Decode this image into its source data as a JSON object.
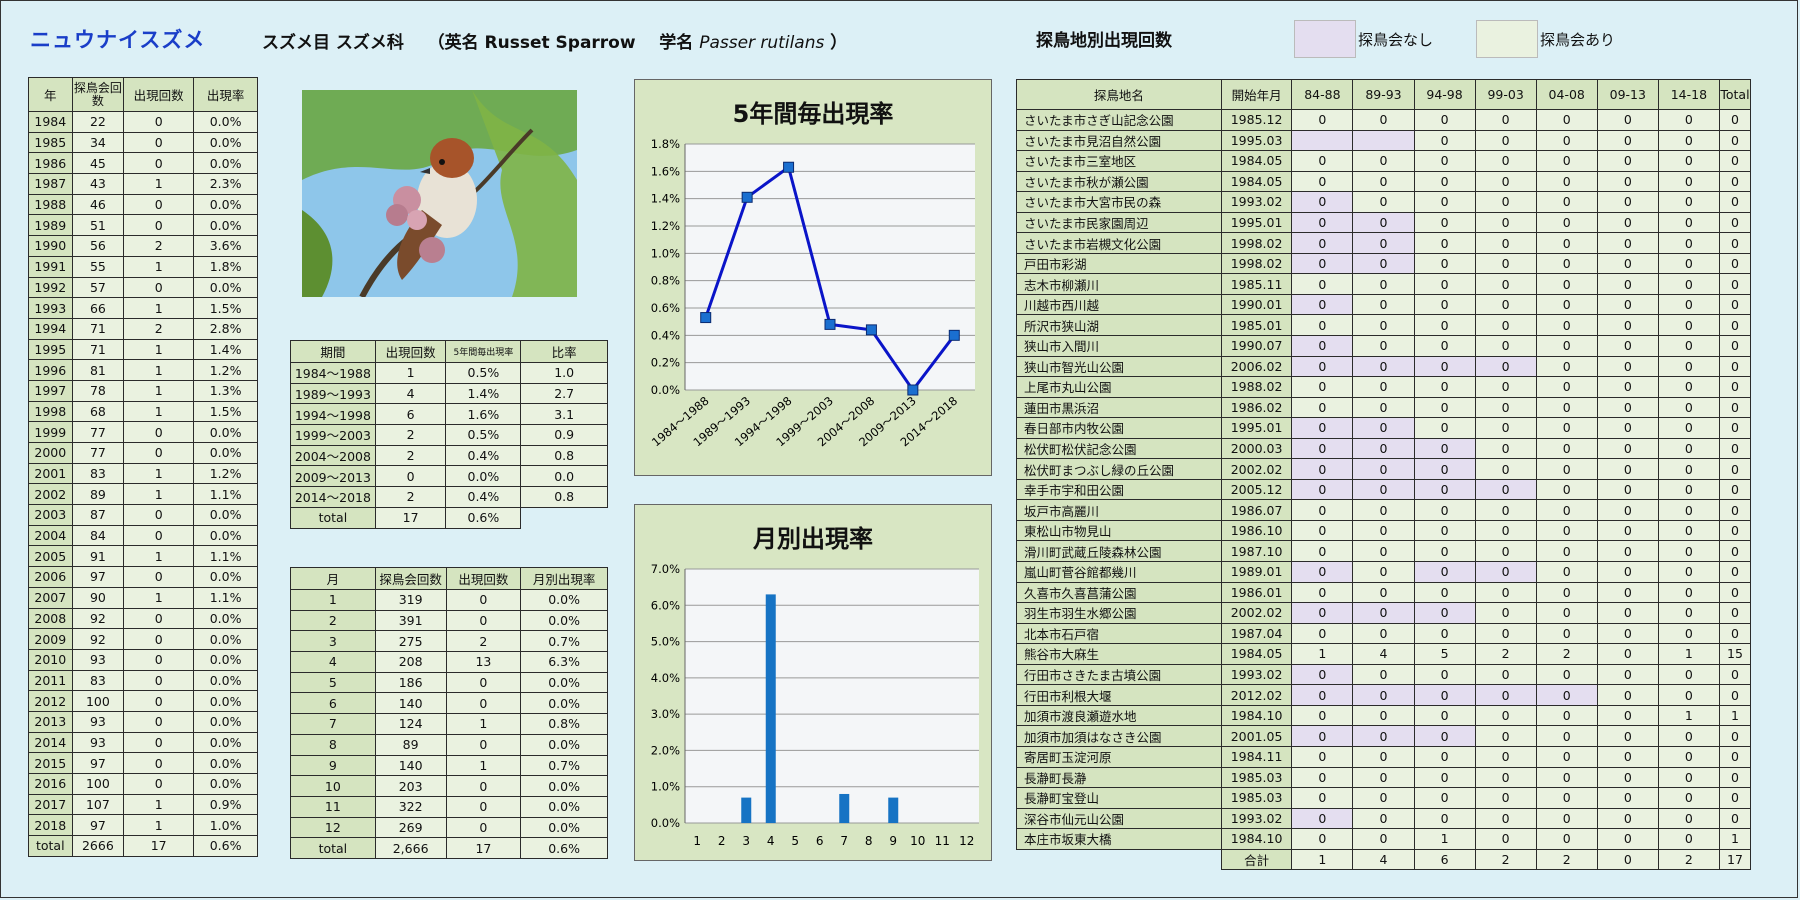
{
  "header": {
    "title": "ニュウナイスズメ",
    "order_family": "スズメ目 スズメ科",
    "english_prefix": "（英名 Russet Sparrow",
    "sci_prefix": "学名",
    "sci_name": "Passer rutilans",
    "close_paren": "）",
    "site_table_title": "探鳥地別出現回数",
    "legend_none": "探鳥会なし",
    "legend_exists": "探鳥会あり"
  },
  "colors": {
    "lavender": "#e4def0",
    "green_light": "#eaf2e0",
    "green_header": "#d5e4c0",
    "line": "#0a14c8",
    "bar": "#1673c4",
    "title": "#1a3ec8"
  },
  "year_table": {
    "headers": [
      "年",
      "探鳥会回数",
      "出現回数",
      "出現率"
    ],
    "rows": [
      [
        "1984",
        "22",
        "0",
        "0.0%"
      ],
      [
        "1985",
        "34",
        "0",
        "0.0%"
      ],
      [
        "1986",
        "45",
        "0",
        "0.0%"
      ],
      [
        "1987",
        "43",
        "1",
        "2.3%"
      ],
      [
        "1988",
        "46",
        "0",
        "0.0%"
      ],
      [
        "1989",
        "51",
        "0",
        "0.0%"
      ],
      [
        "1990",
        "56",
        "2",
        "3.6%"
      ],
      [
        "1991",
        "55",
        "1",
        "1.8%"
      ],
      [
        "1992",
        "57",
        "0",
        "0.0%"
      ],
      [
        "1993",
        "66",
        "1",
        "1.5%"
      ],
      [
        "1994",
        "71",
        "2",
        "2.8%"
      ],
      [
        "1995",
        "71",
        "1",
        "1.4%"
      ],
      [
        "1996",
        "81",
        "1",
        "1.2%"
      ],
      [
        "1997",
        "78",
        "1",
        "1.3%"
      ],
      [
        "1998",
        "68",
        "1",
        "1.5%"
      ],
      [
        "1999",
        "77",
        "0",
        "0.0%"
      ],
      [
        "2000",
        "77",
        "0",
        "0.0%"
      ],
      [
        "2001",
        "83",
        "1",
        "1.2%"
      ],
      [
        "2002",
        "89",
        "1",
        "1.1%"
      ],
      [
        "2003",
        "87",
        "0",
        "0.0%"
      ],
      [
        "2004",
        "84",
        "0",
        "0.0%"
      ],
      [
        "2005",
        "91",
        "1",
        "1.1%"
      ],
      [
        "2006",
        "97",
        "0",
        "0.0%"
      ],
      [
        "2007",
        "90",
        "1",
        "1.1%"
      ],
      [
        "2008",
        "92",
        "0",
        "0.0%"
      ],
      [
        "2009",
        "92",
        "0",
        "0.0%"
      ],
      [
        "2010",
        "93",
        "0",
        "0.0%"
      ],
      [
        "2011",
        "83",
        "0",
        "0.0%"
      ],
      [
        "2012",
        "100",
        "0",
        "0.0%"
      ],
      [
        "2013",
        "93",
        "0",
        "0.0%"
      ],
      [
        "2014",
        "93",
        "0",
        "0.0%"
      ],
      [
        "2015",
        "97",
        "0",
        "0.0%"
      ],
      [
        "2016",
        "100",
        "0",
        "0.0%"
      ],
      [
        "2017",
        "107",
        "1",
        "0.9%"
      ],
      [
        "2018",
        "97",
        "1",
        "1.0%"
      ]
    ],
    "total": [
      "total",
      "2666",
      "17",
      "0.6%"
    ]
  },
  "period_table": {
    "headers": [
      "期間",
      "出現回数",
      "5年間毎出現率",
      "比率"
    ],
    "rows": [
      [
        "1984～1988",
        "1",
        "0.5%",
        "1.0"
      ],
      [
        "1989～1993",
        "4",
        "1.4%",
        "2.7"
      ],
      [
        "1994～1998",
        "6",
        "1.6%",
        "3.1"
      ],
      [
        "1999～2003",
        "2",
        "0.5%",
        "0.9"
      ],
      [
        "2004～2008",
        "2",
        "0.4%",
        "0.8"
      ],
      [
        "2009～2013",
        "0",
        "0.0%",
        "0.0"
      ],
      [
        "2014～2018",
        "2",
        "0.4%",
        "0.8"
      ]
    ],
    "total": [
      "total",
      "17",
      "0.6%"
    ]
  },
  "month_table": {
    "headers": [
      "月",
      "探鳥会回数",
      "出現回数",
      "月別出現率"
    ],
    "rows": [
      [
        "1",
        "319",
        "0",
        "0.0%"
      ],
      [
        "2",
        "391",
        "0",
        "0.0%"
      ],
      [
        "3",
        "275",
        "2",
        "0.7%"
      ],
      [
        "4",
        "208",
        "13",
        "6.3%"
      ],
      [
        "5",
        "186",
        "0",
        "0.0%"
      ],
      [
        "6",
        "140",
        "0",
        "0.0%"
      ],
      [
        "7",
        "124",
        "1",
        "0.8%"
      ],
      [
        "8",
        "89",
        "0",
        "0.0%"
      ],
      [
        "9",
        "140",
        "1",
        "0.7%"
      ],
      [
        "10",
        "203",
        "0",
        "0.0%"
      ],
      [
        "11",
        "322",
        "0",
        "0.0%"
      ],
      [
        "12",
        "269",
        "0",
        "0.0%"
      ]
    ],
    "total": [
      "total",
      "2,666",
      "17",
      "0.6%"
    ]
  },
  "site_table": {
    "headers": [
      "探鳥地名",
      "開始年月",
      "84-88",
      "89-93",
      "94-98",
      "99-03",
      "04-08",
      "09-13",
      "14-18",
      "Total"
    ],
    "rows": [
      {
        "name": "さいたま市さぎ山記念公園",
        "start": "1985.12",
        "v": [
          "0",
          "0",
          "0",
          "0",
          "0",
          "0",
          "0",
          "0"
        ],
        "lav": []
      },
      {
        "name": "さいたま市見沼自然公園",
        "start": "1995.03",
        "v": [
          "",
          "",
          "0",
          "0",
          "0",
          "0",
          "0",
          "0"
        ],
        "lav": [
          0,
          1
        ]
      },
      {
        "name": "さいたま市三室地区",
        "start": "1984.05",
        "v": [
          "0",
          "0",
          "0",
          "0",
          "0",
          "0",
          "0",
          "0"
        ],
        "lav": []
      },
      {
        "name": "さいたま市秋が瀬公園",
        "start": "1984.05",
        "v": [
          "0",
          "0",
          "0",
          "0",
          "0",
          "0",
          "0",
          "0"
        ],
        "lav": []
      },
      {
        "name": "さいたま市大宮市民の森",
        "start": "1993.02",
        "v": [
          "0",
          "0",
          "0",
          "0",
          "0",
          "0",
          "0",
          "0"
        ],
        "lav": [
          0
        ]
      },
      {
        "name": "さいたま市民家園周辺",
        "start": "1995.01",
        "v": [
          "0",
          "0",
          "0",
          "0",
          "0",
          "0",
          "0",
          "0"
        ],
        "lav": [
          0,
          1
        ]
      },
      {
        "name": "さいたま市岩槻文化公園",
        "start": "1998.02",
        "v": [
          "0",
          "0",
          "0",
          "0",
          "0",
          "0",
          "0",
          "0"
        ],
        "lav": [
          0,
          1
        ]
      },
      {
        "name": "戸田市彩湖",
        "start": "1998.02",
        "v": [
          "0",
          "0",
          "0",
          "0",
          "0",
          "0",
          "0",
          "0"
        ],
        "lav": [
          0,
          1
        ]
      },
      {
        "name": "志木市柳瀬川",
        "start": "1985.11",
        "v": [
          "0",
          "0",
          "0",
          "0",
          "0",
          "0",
          "0",
          "0"
        ],
        "lav": []
      },
      {
        "name": "川越市西川越",
        "start": "1990.01",
        "v": [
          "0",
          "0",
          "0",
          "0",
          "0",
          "0",
          "0",
          "0"
        ],
        "lav": [
          0
        ]
      },
      {
        "name": "所沢市狭山湖",
        "start": "1985.01",
        "v": [
          "0",
          "0",
          "0",
          "0",
          "0",
          "0",
          "0",
          "0"
        ],
        "lav": []
      },
      {
        "name": "狭山市入間川",
        "start": "1990.07",
        "v": [
          "0",
          "0",
          "0",
          "0",
          "0",
          "0",
          "0",
          "0"
        ],
        "lav": [
          0
        ]
      },
      {
        "name": "狭山市智光山公園",
        "start": "2006.02",
        "v": [
          "0",
          "0",
          "0",
          "0",
          "0",
          "0",
          "0",
          "0"
        ],
        "lav": [
          0,
          1,
          2,
          3
        ]
      },
      {
        "name": "上尾市丸山公園",
        "start": "1988.02",
        "v": [
          "0",
          "0",
          "0",
          "0",
          "0",
          "0",
          "0",
          "0"
        ],
        "lav": []
      },
      {
        "name": "蓮田市黒浜沼",
        "start": "1986.02",
        "v": [
          "0",
          "0",
          "0",
          "0",
          "0",
          "0",
          "0",
          "0"
        ],
        "lav": []
      },
      {
        "name": "春日部市内牧公園",
        "start": "1995.01",
        "v": [
          "0",
          "0",
          "0",
          "0",
          "0",
          "0",
          "0",
          "0"
        ],
        "lav": [
          0,
          1
        ]
      },
      {
        "name": "松伏町松伏記念公園",
        "start": "2000.03",
        "v": [
          "0",
          "0",
          "0",
          "0",
          "0",
          "0",
          "0",
          "0"
        ],
        "lav": [
          0,
          1,
          2
        ]
      },
      {
        "name": "松伏町まつぶし緑の丘公園",
        "start": "2002.02",
        "v": [
          "0",
          "0",
          "0",
          "0",
          "0",
          "0",
          "0",
          "0"
        ],
        "lav": [
          0,
          1,
          2
        ]
      },
      {
        "name": "幸手市宇和田公園",
        "start": "2005.12",
        "v": [
          "0",
          "0",
          "0",
          "0",
          "0",
          "0",
          "0",
          "0"
        ],
        "lav": [
          0,
          1,
          2,
          3
        ]
      },
      {
        "name": "坂戸市高麗川",
        "start": "1986.07",
        "v": [
          "0",
          "0",
          "0",
          "0",
          "0",
          "0",
          "0",
          "0"
        ],
        "lav": []
      },
      {
        "name": "東松山市物見山",
        "start": "1986.10",
        "v": [
          "0",
          "0",
          "0",
          "0",
          "0",
          "0",
          "0",
          "0"
        ],
        "lav": []
      },
      {
        "name": "滑川町武蔵丘陵森林公園",
        "start": "1987.10",
        "v": [
          "0",
          "0",
          "0",
          "0",
          "0",
          "0",
          "0",
          "0"
        ],
        "lav": []
      },
      {
        "name": "嵐山町菅谷館都幾川",
        "start": "1989.01",
        "v": [
          "0",
          "0",
          "0",
          "0",
          "0",
          "0",
          "0",
          "0"
        ],
        "lav": [
          0,
          2,
          3
        ]
      },
      {
        "name": "久喜市久喜菖蒲公園",
        "start": "1986.01",
        "v": [
          "0",
          "0",
          "0",
          "0",
          "0",
          "0",
          "0",
          "0"
        ],
        "lav": []
      },
      {
        "name": "羽生市羽生水郷公園",
        "start": "2002.02",
        "v": [
          "0",
          "0",
          "0",
          "0",
          "0",
          "0",
          "0",
          "0"
        ],
        "lav": [
          0,
          1,
          2
        ]
      },
      {
        "name": "北本市石戸宿",
        "start": "1987.04",
        "v": [
          "0",
          "0",
          "0",
          "0",
          "0",
          "0",
          "0",
          "0"
        ],
        "lav": []
      },
      {
        "name": "熊谷市大麻生",
        "start": "1984.05",
        "v": [
          "1",
          "4",
          "5",
          "2",
          "2",
          "0",
          "1",
          "15"
        ],
        "lav": []
      },
      {
        "name": "行田市さきたま古墳公園",
        "start": "1993.02",
        "v": [
          "0",
          "0",
          "0",
          "0",
          "0",
          "0",
          "0",
          "0"
        ],
        "lav": [
          0
        ]
      },
      {
        "name": "行田市利根大堰",
        "start": "2012.02",
        "v": [
          "0",
          "0",
          "0",
          "0",
          "0",
          "0",
          "0",
          "0"
        ],
        "lav": [
          0,
          1,
          2,
          3,
          4
        ]
      },
      {
        "name": "加須市渡良瀬遊水地",
        "start": "1984.10",
        "v": [
          "0",
          "0",
          "0",
          "0",
          "0",
          "0",
          "1",
          "1"
        ],
        "lav": []
      },
      {
        "name": "加須市加須はなさき公園",
        "start": "2001.05",
        "v": [
          "0",
          "0",
          "0",
          "0",
          "0",
          "0",
          "0",
          "0"
        ],
        "lav": [
          0,
          1,
          2
        ]
      },
      {
        "name": "寄居町玉淀河原",
        "start": "1984.11",
        "v": [
          "0",
          "0",
          "0",
          "0",
          "0",
          "0",
          "0",
          "0"
        ],
        "lav": []
      },
      {
        "name": "長瀞町長瀞",
        "start": "1985.03",
        "v": [
          "0",
          "0",
          "0",
          "0",
          "0",
          "0",
          "0",
          "0"
        ],
        "lav": []
      },
      {
        "name": "長瀞町宝登山",
        "start": "1985.03",
        "v": [
          "0",
          "0",
          "0",
          "0",
          "0",
          "0",
          "0",
          "0"
        ],
        "lav": []
      },
      {
        "name": "深谷市仙元山公園",
        "start": "1993.02",
        "v": [
          "0",
          "0",
          "0",
          "0",
          "0",
          "0",
          "0",
          "0"
        ],
        "lav": [
          0
        ]
      },
      {
        "name": "本庄市坂東大橋",
        "start": "1984.10",
        "v": [
          "0",
          "0",
          "1",
          "0",
          "0",
          "0",
          "0",
          "1"
        ],
        "lav": []
      }
    ],
    "total_label": "合計",
    "totals": [
      "1",
      "4",
      "6",
      "2",
      "2",
      "0",
      "2",
      "17"
    ]
  },
  "chart_data": [
    {
      "type": "line",
      "title": "5年間毎出現率",
      "categories": [
        "1984～1988",
        "1989～1993",
        "1994～1998",
        "1999～2003",
        "2004～2008",
        "2009～2013",
        "2014～2018"
      ],
      "values": [
        0.53,
        1.41,
        1.63,
        0.48,
        0.44,
        0.0,
        0.4
      ],
      "y_ticks": [
        "0.0%",
        "0.2%",
        "0.4%",
        "0.6%",
        "0.8%",
        "1.0%",
        "1.2%",
        "1.4%",
        "1.6%",
        "1.8%"
      ],
      "ylim": [
        0,
        1.8
      ],
      "grid": true
    },
    {
      "type": "bar",
      "title": "月別出現率",
      "categories": [
        "1",
        "2",
        "3",
        "4",
        "5",
        "6",
        "7",
        "8",
        "9",
        "10",
        "11",
        "12"
      ],
      "values": [
        0,
        0,
        0.7,
        6.3,
        0,
        0,
        0.8,
        0,
        0.7,
        0,
        0,
        0
      ],
      "y_ticks": [
        "0.0%",
        "1.0%",
        "2.0%",
        "3.0%",
        "4.0%",
        "5.0%",
        "6.0%",
        "7.0%"
      ],
      "ylim": [
        0,
        7
      ],
      "grid": true
    }
  ]
}
